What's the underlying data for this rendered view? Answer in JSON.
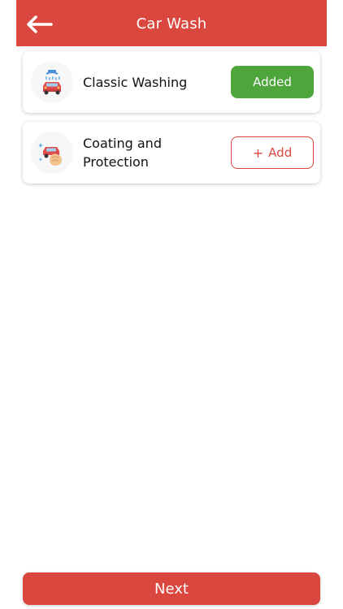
{
  "header": {
    "title": "Car Wash",
    "back_icon": "arrow-left-icon"
  },
  "services": [
    {
      "name": "Classic Washing",
      "icon": "car-wash-icon",
      "button_label": "Added",
      "state": "added"
    },
    {
      "name_line1": "Coating and",
      "name_line2": "Protection",
      "icon": "car-coating-icon",
      "button_plus": "+",
      "button_label": "Add",
      "state": "not-added"
    }
  ],
  "footer": {
    "next_label": "Next"
  },
  "colors": {
    "primary": "#d9473f",
    "success": "#4da53c",
    "background": "#ffffff"
  }
}
